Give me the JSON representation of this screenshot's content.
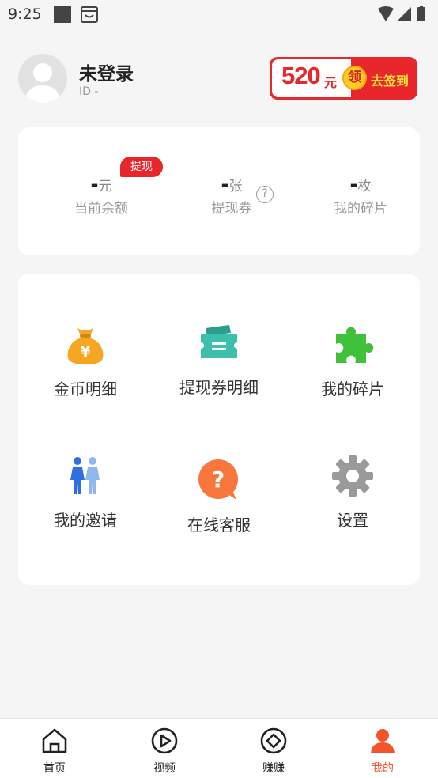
{
  "status_bar": {
    "time": "9:25"
  },
  "profile": {
    "username": "未登录",
    "user_id": "ID  -"
  },
  "sign_in_button": {
    "amount": "520",
    "unit": "元",
    "coin_char": "领",
    "action": "去签到"
  },
  "stats": [
    {
      "value": "-",
      "unit": "元",
      "label": "当前余额"
    },
    {
      "value": "-",
      "unit": "张",
      "label": "提现券"
    },
    {
      "value": "-",
      "unit": "枚",
      "label": "我的碎片"
    }
  ],
  "withdraw_badge": "提现",
  "help_symbol": "?",
  "menu": [
    {
      "label": "金币明细",
      "icon": "money-bag-icon"
    },
    {
      "label": "提现券明细",
      "icon": "ticket-icon"
    },
    {
      "label": "我的碎片",
      "icon": "puzzle-icon"
    },
    {
      "label": "我的邀请",
      "icon": "people-icon"
    },
    {
      "label": "在线客服",
      "icon": "help-bubble-icon"
    },
    {
      "label": "设置",
      "icon": "gear-icon"
    }
  ],
  "bottom_nav": [
    {
      "label": "首页",
      "icon": "home-icon"
    },
    {
      "label": "视频",
      "icon": "video-play-icon"
    },
    {
      "label": "赚赚",
      "icon": "diamond-icon"
    },
    {
      "label": "我的",
      "icon": "person-icon",
      "active": true
    }
  ],
  "colors": {
    "accent_red": "#e8262b",
    "active_nav": "#f2542c",
    "background": "#f5f5f5"
  }
}
